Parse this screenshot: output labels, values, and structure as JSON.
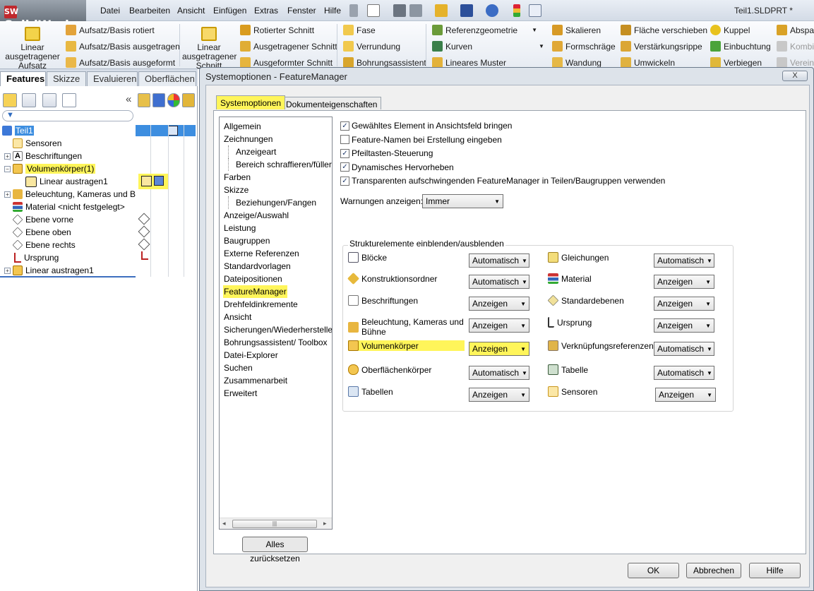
{
  "app": {
    "logo": "SolidWorks",
    "logo_mark": "SW",
    "document_title": "Teil1.SLDPRT *"
  },
  "menu": [
    "Datei",
    "Bearbeiten",
    "Ansicht",
    "Einfügen",
    "Extras",
    "Fenster",
    "Hilfe"
  ],
  "ribbon": {
    "big1": "Linear ausgetragener Aufsatz",
    "big2": "Linear ausgetragener Schnitt",
    "col1": [
      "Aufsatz/Basis rotiert",
      "Aufsatz/Basis ausgetragen",
      "Aufsatz/Basis ausgeformt"
    ],
    "col2": [
      "Rotierter Schnitt",
      "Ausgetragener Schnitt",
      "Ausgeformter Schnitt"
    ],
    "col3": [
      "Fase",
      "Verrundung",
      "Bohrungsassistent"
    ],
    "col4": [
      "Referenzgeometrie",
      "Kurven",
      "Lineares Muster"
    ],
    "col5": [
      "Skalieren",
      "Formschräge",
      "Wandung"
    ],
    "col6": [
      "Fläche verschieben",
      "Verstärkungsrippe",
      "Umwickeln"
    ],
    "col7": [
      "Kuppel",
      "Einbuchtung",
      "Verbiegen"
    ],
    "col8": [
      "Abspal",
      "Kombin",
      "Vereinig"
    ]
  },
  "left_tabs": [
    "Features",
    "Skizze",
    "Evaluieren",
    "Oberflächen"
  ],
  "collapse_symbol": "«",
  "tree": [
    {
      "label": "Teil1"
    },
    {
      "label": "Sensoren"
    },
    {
      "label": "Beschriftungen"
    },
    {
      "label": "Volumenkörper(1)"
    },
    {
      "label": "Linear austragen1"
    },
    {
      "label": "Beleuchtung, Kameras und B"
    },
    {
      "label": "Material <nicht festgelegt>"
    },
    {
      "label": "Ebene vorne"
    },
    {
      "label": "Ebene oben"
    },
    {
      "label": "Ebene rechts"
    },
    {
      "label": "Ursprung"
    },
    {
      "label": "Linear austragen1"
    }
  ],
  "dialog": {
    "title": "Systemoptionen - FeatureManager",
    "close": "X",
    "tabs": [
      "Systemoptionen",
      "Dokumenteigenschaften"
    ],
    "categories": [
      "Allgemein",
      "Zeichnungen",
      "Anzeigeart",
      "Bereich schraffieren/füller",
      "Farben",
      "Skizze",
      "Beziehungen/Fangen",
      "Anzeige/Auswahl",
      "Leistung",
      "Baugruppen",
      "Externe Referenzen",
      "Standardvorlagen",
      "Dateipositionen",
      "FeatureManager",
      "Drehfeldinkremente",
      "Ansicht",
      "Sicherungen/Wiederhersteller",
      "Bohrungsassistent/ Toolbox",
      "Datei-Explorer",
      "Suchen",
      "Zusammenarbeit",
      "Erweitert"
    ],
    "checkboxes": [
      {
        "label": "Gewähltes Element in Ansichtsfeld bringen",
        "checked": "✓"
      },
      {
        "label": "Feature-Namen bei Erstellung eingeben",
        "checked": ""
      },
      {
        "label": "Pfeiltasten-Steuerung",
        "checked": "✓"
      },
      {
        "label": "Dynamisches Hervorheben",
        "checked": "✓"
      },
      {
        "label": "Transparenten aufschwingenden FeatureManager in Teilen/Baugruppen verwenden",
        "checked": "✓"
      }
    ],
    "warn_label": "Warnungen anzeigen:",
    "warn_value": "Immer",
    "group_title": "Strukturelemente einblenden/ausblenden",
    "left_items": [
      {
        "label": "Blöcke",
        "value": "Automatisch"
      },
      {
        "label": "Konstruktionsordner",
        "value": "Automatisch"
      },
      {
        "label": "Beschriftungen",
        "value": "Anzeigen"
      },
      {
        "label": "Beleuchtung, Kameras und Bühne",
        "value": "Anzeigen"
      },
      {
        "label": "Volumenkörper",
        "value": "Anzeigen"
      },
      {
        "label": "Oberflächenkörper",
        "value": "Automatisch"
      },
      {
        "label": "Tabellen",
        "value": "Anzeigen"
      }
    ],
    "right_items": [
      {
        "label": "Gleichungen",
        "value": "Automatisch"
      },
      {
        "label": "Material",
        "value": "Anzeigen"
      },
      {
        "label": "Standardebenen",
        "value": "Anzeigen"
      },
      {
        "label": "Ursprung",
        "value": "Anzeigen"
      },
      {
        "label": "Verknüpfungsreferenzen",
        "value": "Automatisch"
      },
      {
        "label": "Tabelle",
        "value": "Automatisch"
      },
      {
        "label": "Sensoren",
        "value": "Anzeigen"
      }
    ],
    "reset": "Alles zurücksetzen",
    "ok": "OK",
    "cancel": "Abbrechen",
    "help": "Hilfe"
  },
  "colors": {
    "highlight": "#fff55a",
    "selection": "#3d8ee0"
  }
}
